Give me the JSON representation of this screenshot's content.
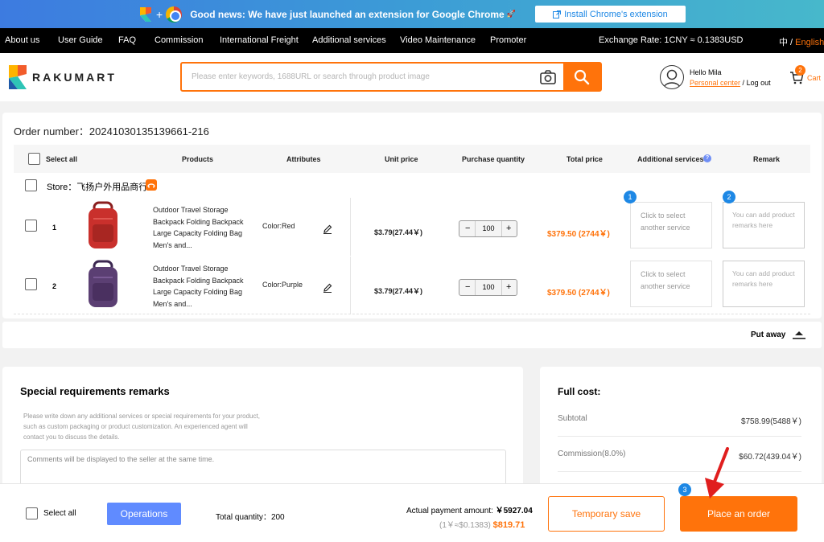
{
  "banner": {
    "message": "Good news: We have just launched an extension for Google Chrome",
    "button_label": "Install Chrome's extension"
  },
  "topnav": {
    "items": [
      "About us",
      "User Guide",
      "FAQ",
      "Commission",
      "International Freight",
      "Additional services",
      "Video Maintenance",
      "Promoter"
    ],
    "exchange_rate": "Exchange Rate: 1CNY ≈ 0.1383USD",
    "lang_cn": "中",
    "lang_sep": " / ",
    "lang_en": "English"
  },
  "header": {
    "logo_text": "RAKUMART",
    "search_placeholder": "Please enter keywords, 1688URL or search through product image",
    "hello": "Hello Mila",
    "personal_center": "Personal center",
    "logout_sep": " / ",
    "logout": "Log out",
    "cart_count": "2",
    "cart_label": "Cart"
  },
  "order": {
    "number_label": "Order number：",
    "number": "20241030135139661-216",
    "columns": {
      "select_all": "Select all",
      "products": "Products",
      "attributes": "Attributes",
      "unit_price": "Unit price",
      "purchase_quantity": "Purchase quantity",
      "total_price": "Total price",
      "additional_services": "Additional services",
      "remark": "Remark"
    },
    "store_label": "Store：",
    "store_name": "飞扬户外用品商行",
    "items": [
      {
        "index": "1",
        "name": "Outdoor Travel Storage Backpack Folding Backpack Large Capacity Folding Bag Men's and...",
        "attribute": "Color:Red",
        "unit_price": "$3.79(27.44￥)",
        "quantity": "100",
        "total": "$379.50 (2744￥)",
        "service_placeholder": "Click to select another service",
        "remark_placeholder": "You can add product remarks here",
        "color": "#c9302c"
      },
      {
        "index": "2",
        "name": "Outdoor Travel Storage Backpack Folding Backpack Large Capacity Folding Bag Men's and...",
        "attribute": "Color:Purple",
        "unit_price": "$3.79(27.44￥)",
        "quantity": "100",
        "total": "$379.50 (2744￥)",
        "service_placeholder": "Click to select another service",
        "remark_placeholder": "You can add product remarks here",
        "color": "#5b3f73"
      }
    ],
    "put_away": "Put away"
  },
  "tutorial_steps": [
    "1",
    "2",
    "3"
  ],
  "special": {
    "title": "Special requirements remarks",
    "description": "Please write down any additional services or special requirements for your product, such as custom packaging or product customization. An experienced agent will contact you to discuss the details.",
    "textarea_placeholder": "Comments will be displayed to the seller at the same time."
  },
  "cost": {
    "title": "Full cost:",
    "subtotal_label": "Subtotal",
    "subtotal_value": "$758.99(5488￥)",
    "commission_label": "Commission(8.0%)",
    "commission_value": "$60.72(439.04￥)"
  },
  "footer": {
    "select_all": "Select all",
    "operations": "Operations",
    "total_quantity_label": "Total quantity：",
    "total_quantity": "200",
    "actual_payment_label": "Actual payment amount: ",
    "actual_payment_value": "￥5927.04",
    "rate_note": "(1￥≈$0.1383)",
    "usd_total": "$819.71",
    "temporary_save": "Temporary save",
    "place_order": "Place an order"
  },
  "colors": {
    "accent": "#ff730b",
    "blue": "#1e88e5",
    "operations": "#608bff"
  }
}
